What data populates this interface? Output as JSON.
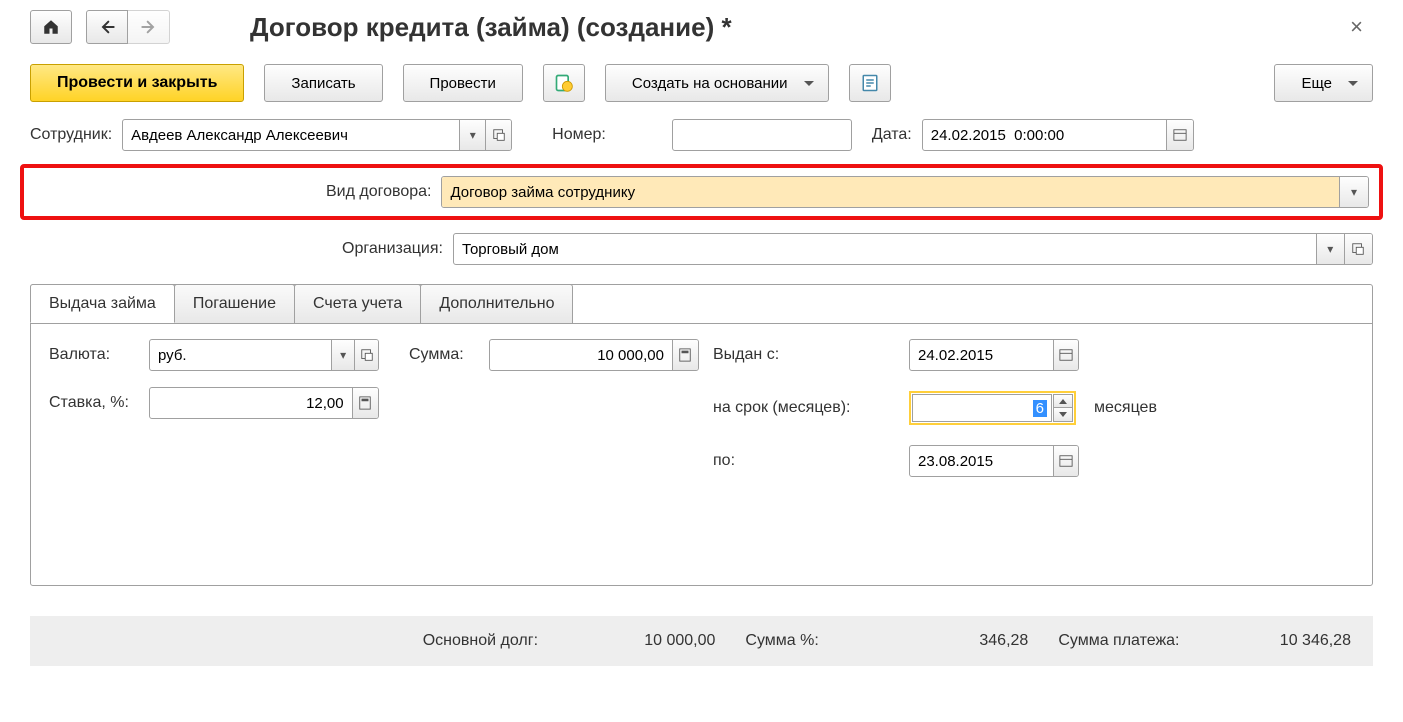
{
  "title": "Договор кредита (займа) (создание) *",
  "toolbar": {
    "post_close": "Провести и закрыть",
    "save": "Записать",
    "post": "Провести",
    "create_based": "Создать на основании",
    "more": "Еще"
  },
  "fields": {
    "employee_label": "Сотрудник:",
    "employee_value": "Авдеев Александр Алексеевич",
    "number_label": "Номер:",
    "number_value": "",
    "date_label": "Дата:",
    "date_value": "24.02.2015  0:00:00",
    "contract_type_label": "Вид договора:",
    "contract_type_value": "Договор займа сотруднику",
    "org_label": "Организация:",
    "org_value": "Торговый дом"
  },
  "tabs": {
    "t1": "Выдача займа",
    "t2": "Погашение",
    "t3": "Счета учета",
    "t4": "Дополнительно"
  },
  "loan": {
    "currency_label": "Валюта:",
    "currency_value": "руб.",
    "sum_label": "Сумма:",
    "sum_value": "10 000,00",
    "rate_label": "Ставка, %:",
    "rate_value": "12,00",
    "issued_label": "Выдан с:",
    "issued_value": "24.02.2015",
    "term_label": "на срок (месяцев):",
    "term_value": "6",
    "term_unit": "месяцев",
    "until_label": "по:",
    "until_value": "23.08.2015"
  },
  "footer": {
    "principal_label": "Основной долг:",
    "principal_value": "10 000,00",
    "interest_label": "Сумма %:",
    "interest_value": "346,28",
    "payment_label": "Сумма платежа:",
    "payment_value": "10 346,28"
  }
}
